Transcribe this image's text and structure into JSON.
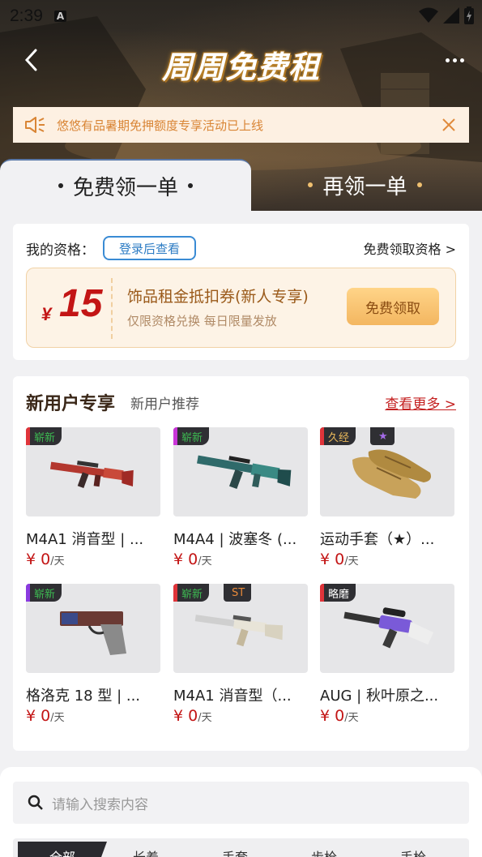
{
  "status_bar": {
    "time": "2:39",
    "badge": "A"
  },
  "header": {
    "title": "周周免费租"
  },
  "notice": {
    "text": "悠悠有品暑期免押额度专享活动已上线"
  },
  "tabs": [
    {
      "label": "免费领一单",
      "active": true
    },
    {
      "label": "再领一单",
      "active": false
    }
  ],
  "eligibility": {
    "label": "我的资格：",
    "login_button": "登录后查看",
    "free_link": "免费领取资格 >",
    "coupon": {
      "currency": "¥",
      "amount": "15",
      "title": "饰品租金抵扣券(新人专享)",
      "subtitle": "仅限资格兑换 每日限量发放",
      "claim_button": "免费领取"
    }
  },
  "new_user": {
    "title": "新用户专享",
    "subtitle": "新用户推荐",
    "more_link": "查看更多 >",
    "items": [
      {
        "wear": "崭新",
        "extra": "",
        "name": "M4A1 消音型 | ...",
        "price": "¥ 0",
        "unit": "/天",
        "rarity_color": "#e0343a"
      },
      {
        "wear": "崭新",
        "extra": "",
        "name": "M4A4 | 波塞冬 (...",
        "price": "¥ 0",
        "unit": "/天",
        "rarity_color": "#c935d8"
      },
      {
        "wear": "久经",
        "extra": "★",
        "name": "运动手套（★）...",
        "price": "¥ 0",
        "unit": "/天",
        "rarity_color": "#e0343a"
      },
      {
        "wear": "崭新",
        "extra": "",
        "name": "格洛克 18 型 | ...",
        "price": "¥ 0",
        "unit": "/天",
        "rarity_color": "#8b3be0"
      },
      {
        "wear": "崭新",
        "extra": "ST",
        "name": "M4A1 消音型（...",
        "price": "¥ 0",
        "unit": "/天",
        "rarity_color": "#e0343a"
      },
      {
        "wear": "略磨",
        "extra": "",
        "name": "AUG | 秋叶原之...",
        "price": "¥ 0",
        "unit": "/天",
        "rarity_color": "#e0343a"
      }
    ]
  },
  "search": {
    "placeholder": "请输入搜索内容"
  },
  "categories": [
    "全部",
    "长着",
    "手套",
    "步枪",
    "手枪"
  ],
  "colors": {
    "accent": "#c31515",
    "notice_text": "#d98535",
    "login_blue": "#2d7cc4"
  }
}
